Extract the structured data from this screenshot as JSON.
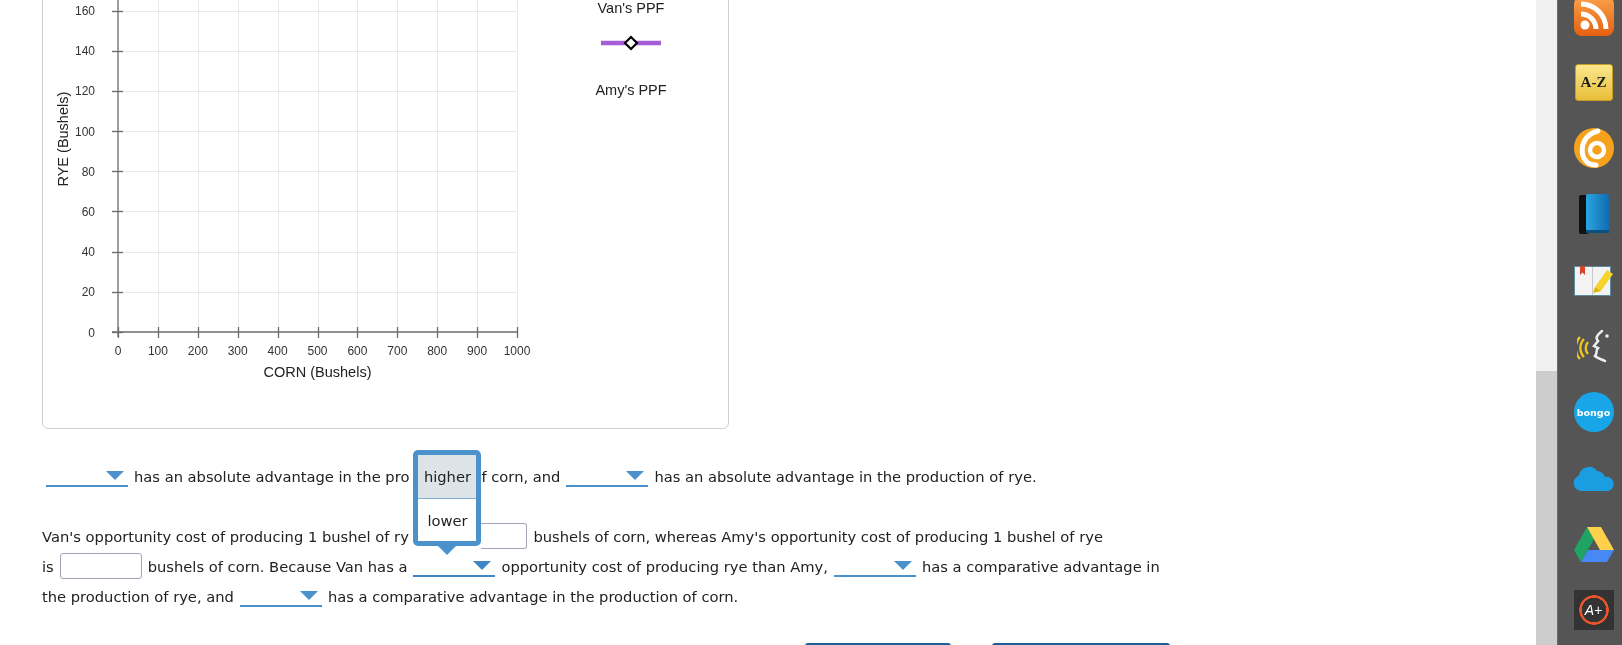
{
  "graph": {
    "chart_data": {
      "type": "line",
      "xlabel": "CORN (Bushels)",
      "ylabel": "RYE (Bushels)",
      "xlim": [
        0,
        1000
      ],
      "ylim": [
        0,
        160
      ],
      "xticks": [
        0,
        100,
        200,
        300,
        400,
        500,
        600,
        700,
        800,
        900,
        1000
      ],
      "yticks": [
        0,
        20,
        40,
        60,
        80,
        100,
        120,
        140,
        160
      ],
      "grid": true
    },
    "tools": [
      {
        "label": "Van's PPF"
      },
      {
        "label": "Amy's PPF",
        "color": "#a45dd6"
      }
    ]
  },
  "question": {
    "paragraphs": [
      {
        "lines": [
          [
            {
              "kind": "dropdown",
              "expanded": false
            },
            {
              "kind": "text",
              "text": "has an absolute advantage in the pro"
            },
            {
              "kind": "text",
              "text": "f corn, and",
              "behind_menu": true
            },
            {
              "kind": "dropdown",
              "expanded": false
            },
            {
              "kind": "text",
              "text": "has an absolute advantage in the production of rye."
            }
          ]
        ]
      },
      {
        "lines": [
          [
            {
              "kind": "text",
              "text": "Van's opportunity cost of producing 1 bushel of ry"
            },
            {
              "kind": "input",
              "behind_menu": true
            },
            {
              "kind": "text",
              "text": "bushels of corn, whereas Amy's opportunity cost of producing 1 bushel of rye"
            }
          ],
          [
            {
              "kind": "text",
              "text": "is"
            },
            {
              "kind": "input"
            },
            {
              "kind": "text",
              "text": "bushels of corn. Because Van has a"
            },
            {
              "kind": "dropdown",
              "expanded": true,
              "options": [
                {
                  "label": "higher",
                  "selected": true
                },
                {
                  "label": "lower",
                  "selected": false
                }
              ]
            },
            {
              "kind": "text",
              "text": "opportunity cost of producing rye than Amy,"
            },
            {
              "kind": "dropdown",
              "expanded": false
            },
            {
              "kind": "text",
              "text": "has a comparative advantage in"
            }
          ],
          [
            {
              "kind": "text",
              "text": "the production of rye, and"
            },
            {
              "kind": "dropdown",
              "expanded": false
            },
            {
              "kind": "text",
              "text": "has a comparative advantage in the production of corn."
            }
          ]
        ]
      }
    ]
  },
  "buttons": [
    {
      "kind": "cut-off"
    },
    {
      "kind": "cut-off"
    }
  ],
  "sidebar": {
    "items": [
      {
        "kind": "rss"
      },
      {
        "kind": "az",
        "label": "A-Z"
      },
      {
        "kind": "swirl"
      },
      {
        "kind": "book"
      },
      {
        "kind": "highlighter"
      },
      {
        "kind": "speech"
      },
      {
        "kind": "bubble",
        "label": "bongo"
      },
      {
        "kind": "cloud"
      },
      {
        "kind": "triangle"
      },
      {
        "kind": "grade",
        "label": "A+"
      }
    ]
  }
}
